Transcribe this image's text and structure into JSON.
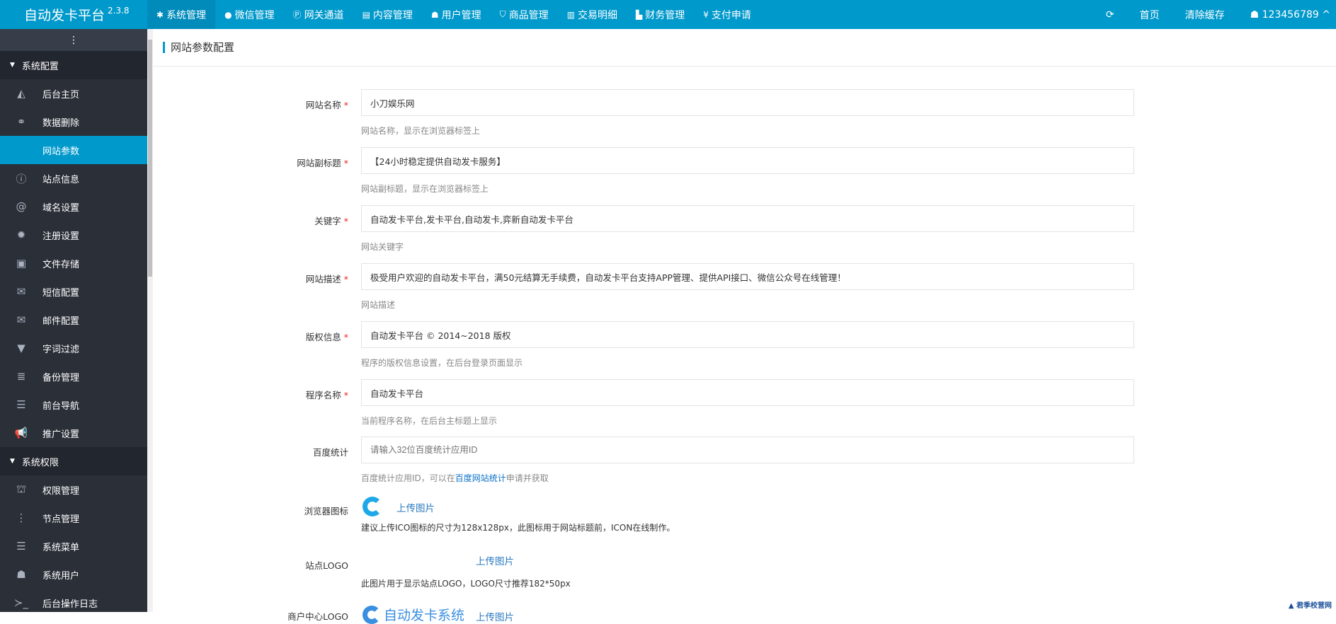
{
  "brand": {
    "name": "自动发卡平台",
    "version": "2.3.8"
  },
  "nav": [
    {
      "icon": "gear-icon",
      "g": "✱",
      "label": "系统管理"
    },
    {
      "icon": "wechat-icon",
      "g": "●",
      "label": "微信管理"
    },
    {
      "icon": "gateway-icon",
      "g": "Ⓟ",
      "label": "网关通道"
    },
    {
      "icon": "file-icon",
      "g": "▤",
      "label": "内容管理"
    },
    {
      "icon": "users-icon",
      "g": "☗",
      "label": "用户管理"
    },
    {
      "icon": "bag-icon",
      "g": "⛉",
      "label": "商品管理"
    },
    {
      "icon": "bar-chart-icon",
      "g": "▥",
      "label": "交易明细"
    },
    {
      "icon": "finance-icon",
      "g": "▙",
      "label": "财务管理"
    },
    {
      "icon": "yen-icon",
      "g": "¥",
      "label": "支付申请"
    }
  ],
  "right": {
    "refresh": "⟳",
    "home": "首页",
    "clear_cache": "清除缓存",
    "user": "123456789"
  },
  "sidebar": {
    "groups": [
      {
        "label": "系统配置",
        "items": [
          {
            "icon": "area-chart-icon",
            "g": "◭",
            "label": "后台主页"
          },
          {
            "icon": "link-icon",
            "g": "⚭",
            "label": "数据删除"
          },
          {
            "icon": "apple-icon",
            "g": "",
            "label": "网站参数"
          },
          {
            "icon": "info-icon",
            "g": "ⓘ",
            "label": "站点信息"
          },
          {
            "icon": "at-icon",
            "g": "@",
            "label": "域名设置"
          },
          {
            "icon": "gear-icon",
            "g": "✹",
            "label": "注册设置"
          },
          {
            "icon": "save-icon",
            "g": "▣",
            "label": "文件存储"
          },
          {
            "icon": "envelope-icon",
            "g": "✉",
            "label": "短信配置"
          },
          {
            "icon": "envelope-icon",
            "g": "✉",
            "label": "邮件配置"
          },
          {
            "icon": "filter-icon",
            "g": "▼",
            "label": "字词过滤"
          },
          {
            "icon": "database-icon",
            "g": "≣",
            "label": "备份管理"
          },
          {
            "icon": "bars-icon",
            "g": "☰",
            "label": "前台导航"
          },
          {
            "icon": "bullhorn-icon",
            "g": "📢",
            "label": "推广设置"
          }
        ]
      },
      {
        "label": "系统权限",
        "items": [
          {
            "icon": "lock-icon",
            "g": "⛫",
            "label": "权限管理"
          },
          {
            "icon": "ellipsis-icon",
            "g": "⋮",
            "label": "节点管理"
          },
          {
            "icon": "menu-icon",
            "g": "☰",
            "label": "系统菜单"
          },
          {
            "icon": "users-icon",
            "g": "☗",
            "label": "系统用户"
          },
          {
            "icon": "terminal-icon",
            "g": "≻_",
            "label": "后台操作日志"
          }
        ]
      }
    ]
  },
  "page_title": "网站参数配置",
  "fields": [
    {
      "label": "网站名称",
      "required": true,
      "value": "小刀娱乐网",
      "help": "网站名称，显示在浏览器标签上"
    },
    {
      "label": "网站副标题",
      "required": true,
      "value": "【24小时稳定提供自动发卡服务】",
      "help": "网站副标题，显示在浏览器标签上"
    },
    {
      "label": "关键字",
      "required": true,
      "value": "自动发卡平台,发卡平台,自动发卡,弈新自动发卡平台",
      "help": "网站关键字"
    },
    {
      "label": "网站描述",
      "required": true,
      "value": "极受用户欢迎的自动发卡平台，满50元结算无手续费，自动发卡平台支持APP管理、提供API接口、微信公众号在线管理！",
      "help": "网站描述"
    },
    {
      "label": "版权信息",
      "required": true,
      "value": "自动发卡平台 © 2014~2018 版权",
      "help": "程序的版权信息设置，在后台登录页面显示"
    },
    {
      "label": "程序名称",
      "required": true,
      "value": "自动发卡平台",
      "help": "当前程序名称，在后台主标题上显示"
    }
  ],
  "baidu": {
    "label": "百度统计",
    "placeholder": "请输入32位百度统计应用ID",
    "help_pre": "百度统计应用ID，可以在",
    "help_link": "百度网站统计",
    "help_post": "申请并获取"
  },
  "favicon": {
    "label": "浏览器图标",
    "upload": "上传图片",
    "note": "建议上传ICO图标的尺寸为128x128px，此图标用于网站标题前，ICON在线制作。"
  },
  "site_logo": {
    "label": "站点LOGO",
    "upload": "上传图片",
    "note": "此图片用于显示站点LOGO，LOGO尺寸推荐182*50px"
  },
  "merchant_logo": {
    "label": "商户中心LOGO",
    "logo_text": "自动发卡系统",
    "upload": "上传图片"
  },
  "required_mark": "*",
  "watermark": "君季校营网"
}
